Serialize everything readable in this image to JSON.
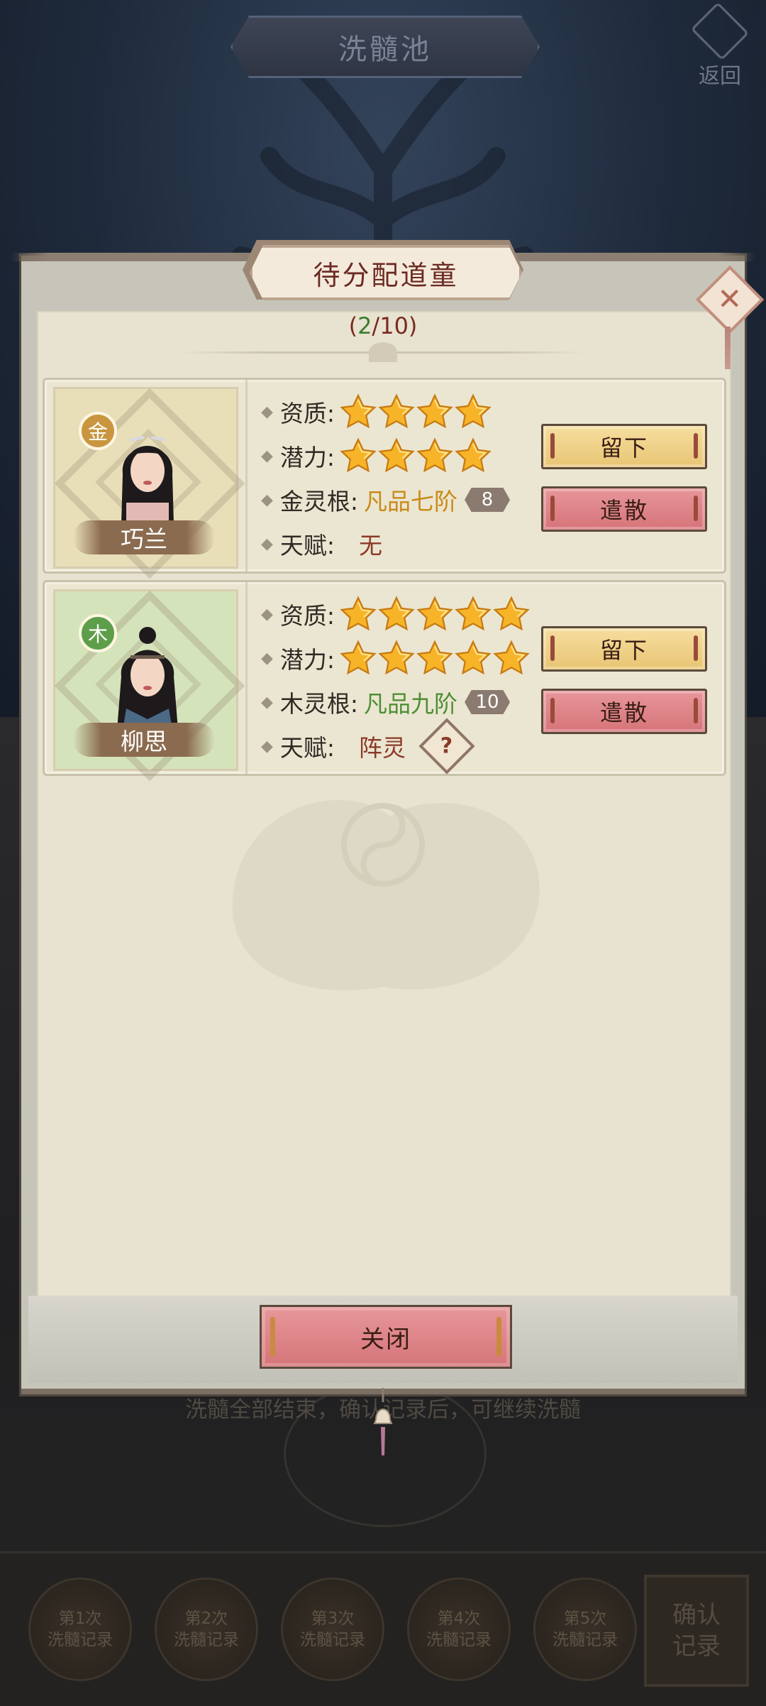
{
  "top_bar": {
    "title": "洗髓池",
    "back_label": "返回"
  },
  "bottom": {
    "hint": "洗髓全部结束，确认记录后，可继续洗髓",
    "records": [
      {
        "line1": "第1次",
        "line2": "洗髓记录"
      },
      {
        "line1": "第2次",
        "line2": "洗髓记录"
      },
      {
        "line1": "第3次",
        "line2": "洗髓记录"
      },
      {
        "line1": "第4次",
        "line2": "洗髓记录"
      },
      {
        "line1": "第5次",
        "line2": "洗髓记录"
      }
    ],
    "confirm_line1": "确认",
    "confirm_line2": "记录"
  },
  "popup": {
    "title": "待分配道童",
    "counter_open": "(",
    "counter_current": "2",
    "counter_rest": "/10)",
    "close_label": "关闭",
    "disciples": [
      {
        "name": "巧兰",
        "element": "金",
        "element_color": "#c9963f",
        "portrait_bg": "#e8dfb9",
        "aptitude_label": "资质:",
        "aptitude_stars": 4,
        "potential_label": "潜力:",
        "potential_stars": 4,
        "root_label": "金灵根:",
        "root_value": "凡品七阶",
        "root_color": "#c98a1a",
        "root_level": "8",
        "talent_label": "天赋:",
        "talent_value": "无",
        "keep_label": "留下",
        "dismiss_label": "遣散"
      },
      {
        "name": "柳思",
        "element": "木",
        "element_color": "#5e9e4a",
        "portrait_bg": "#d5e3bb",
        "aptitude_label": "资质:",
        "aptitude_stars": 5,
        "potential_label": "潜力:",
        "potential_stars": 5,
        "root_label": "木灵根:",
        "root_value": "凡品九阶",
        "root_color": "#4f8f35",
        "root_level": "10",
        "talent_label": "天赋:",
        "talent_value": "阵灵",
        "talent_help": "?",
        "keep_label": "留下",
        "dismiss_label": "遣散"
      }
    ]
  }
}
